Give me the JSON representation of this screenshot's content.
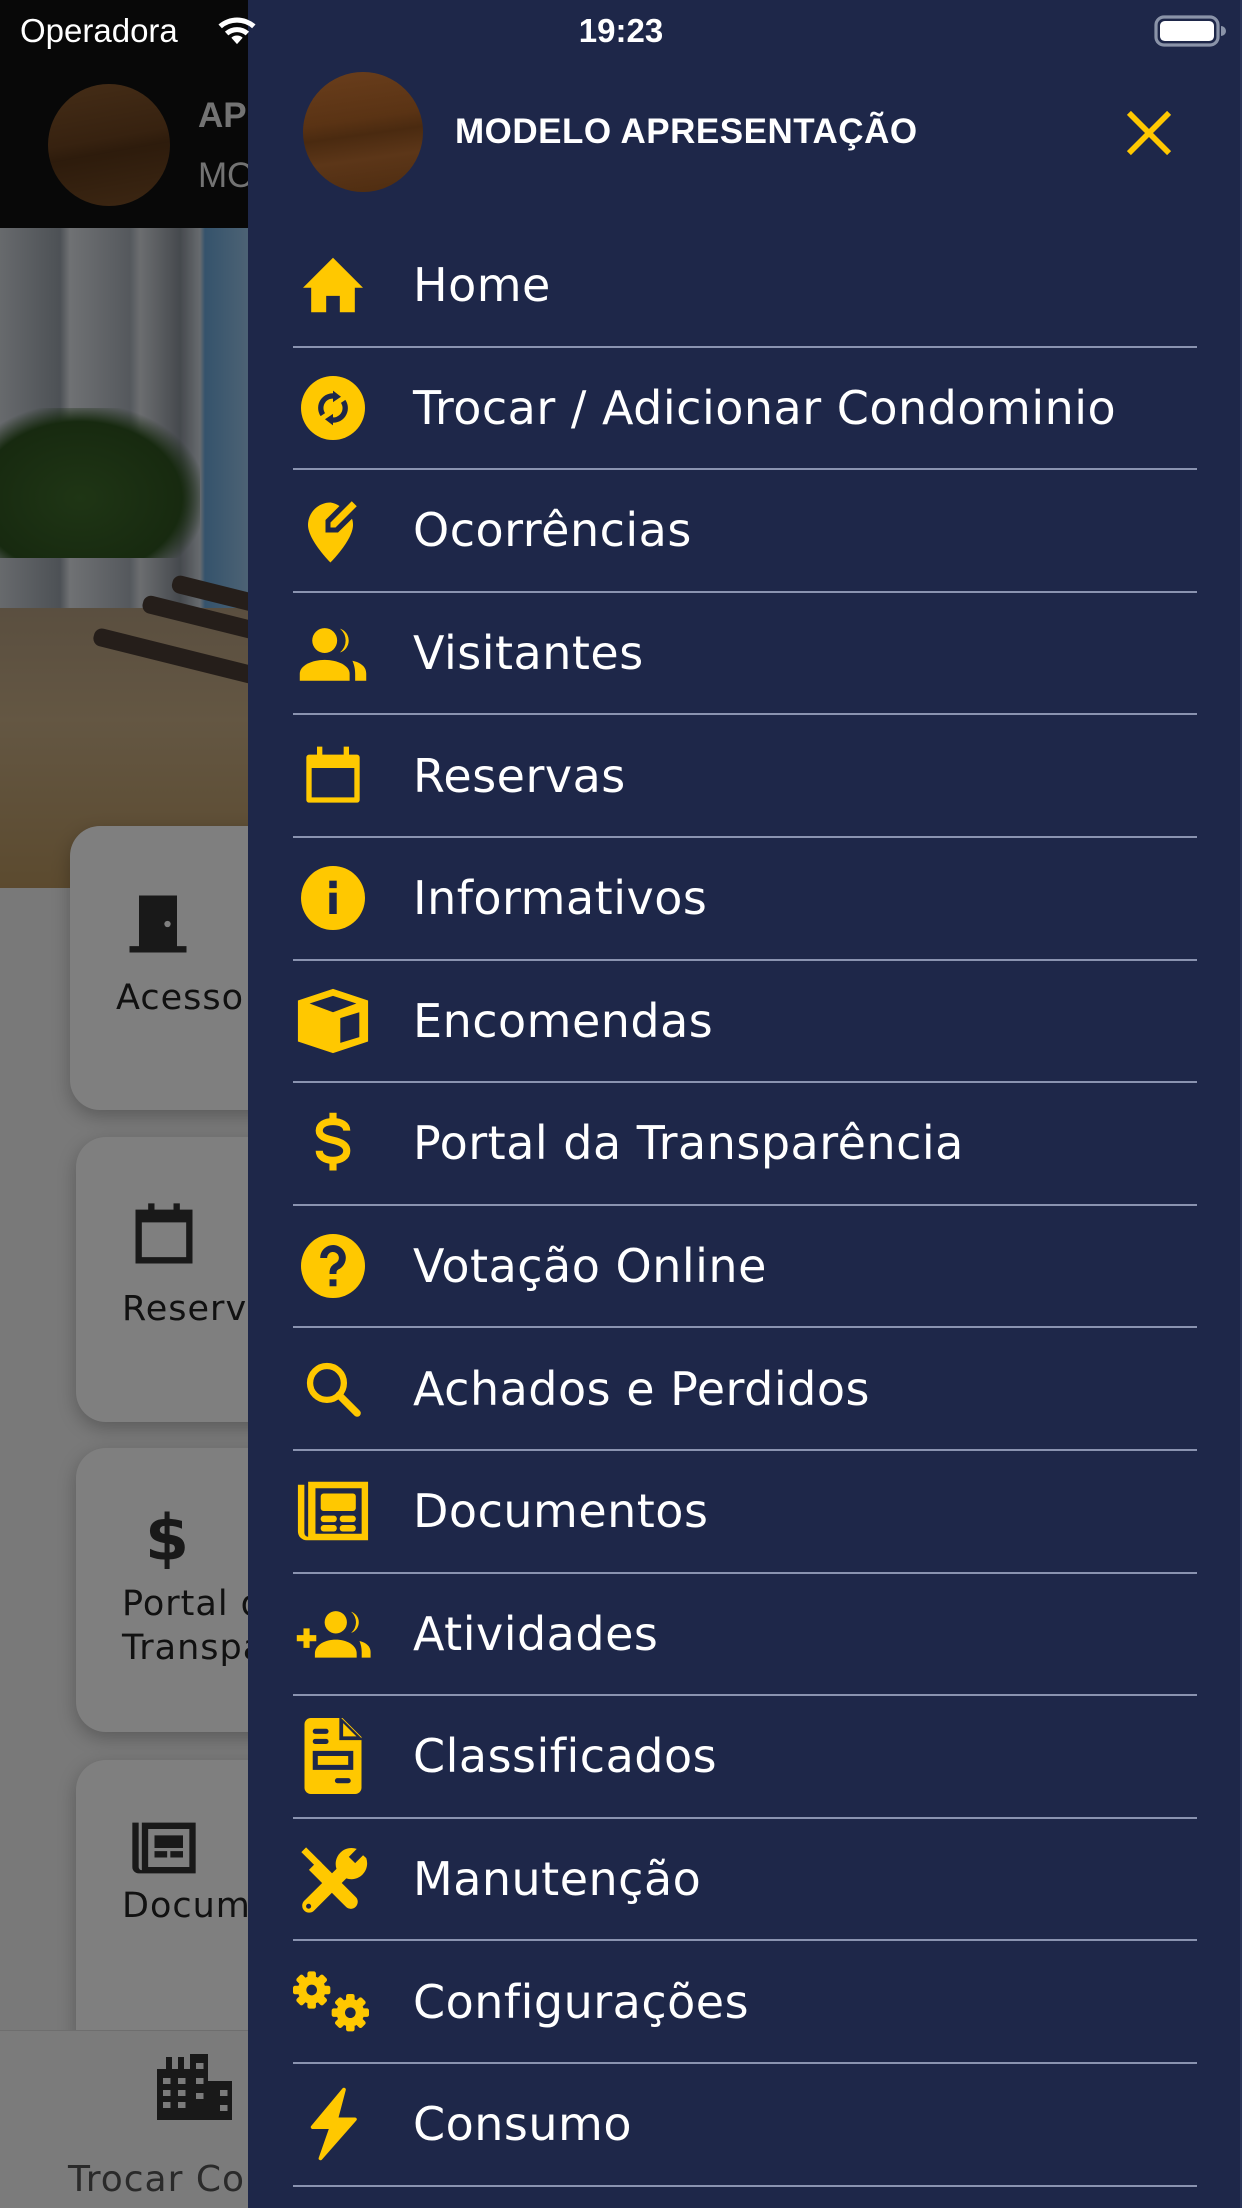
{
  "status_bar": {
    "carrier": "Operadora",
    "time": "19:23",
    "wifi_icon": "wifi-icon",
    "battery_icon": "battery-full-icon"
  },
  "background_app": {
    "header_title": "AP",
    "header_subtitle": "MO",
    "cards": [
      {
        "label": "Acesso",
        "icon": "door-icon"
      },
      {
        "label": "Reserva",
        "icon": "calendar-icon"
      },
      {
        "label": "Portal d\nTranspa",
        "icon": "dollar-icon"
      },
      {
        "label": "Docume",
        "icon": "newspaper-icon"
      }
    ],
    "tab_bar": {
      "label": "Trocar Co",
      "icon": "city-icon"
    }
  },
  "drawer": {
    "title": "MODELO APRESENTAÇÃO",
    "close_icon": "close-icon",
    "accent_color": "#ffc800",
    "background_color": "#1e2749",
    "items": [
      {
        "label": "Home",
        "icon": "home-icon"
      },
      {
        "label": "Trocar / Adicionar Condominio",
        "icon": "sync-circle-icon"
      },
      {
        "label": "Ocorrências",
        "icon": "map-marker-edit-icon"
      },
      {
        "label": "Visitantes",
        "icon": "people-icon"
      },
      {
        "label": "Reservas",
        "icon": "calendar-icon"
      },
      {
        "label": "Informativos",
        "icon": "info-circle-icon"
      },
      {
        "label": "Encomendas",
        "icon": "package-icon"
      },
      {
        "label": "Portal da Transparência",
        "icon": "dollar-icon"
      },
      {
        "label": "Votação Online",
        "icon": "help-circle-icon"
      },
      {
        "label": "Achados e Perdidos",
        "icon": "search-icon"
      },
      {
        "label": "Documentos",
        "icon": "newspaper-icon"
      },
      {
        "label": "Atividades",
        "icon": "group-add-icon"
      },
      {
        "label": "Classificados",
        "icon": "file-document-icon"
      },
      {
        "label": "Manutenção",
        "icon": "tools-icon"
      },
      {
        "label": "Configurações",
        "icon": "cogs-icon"
      },
      {
        "label": "Consumo",
        "icon": "lightning-icon"
      }
    ]
  }
}
